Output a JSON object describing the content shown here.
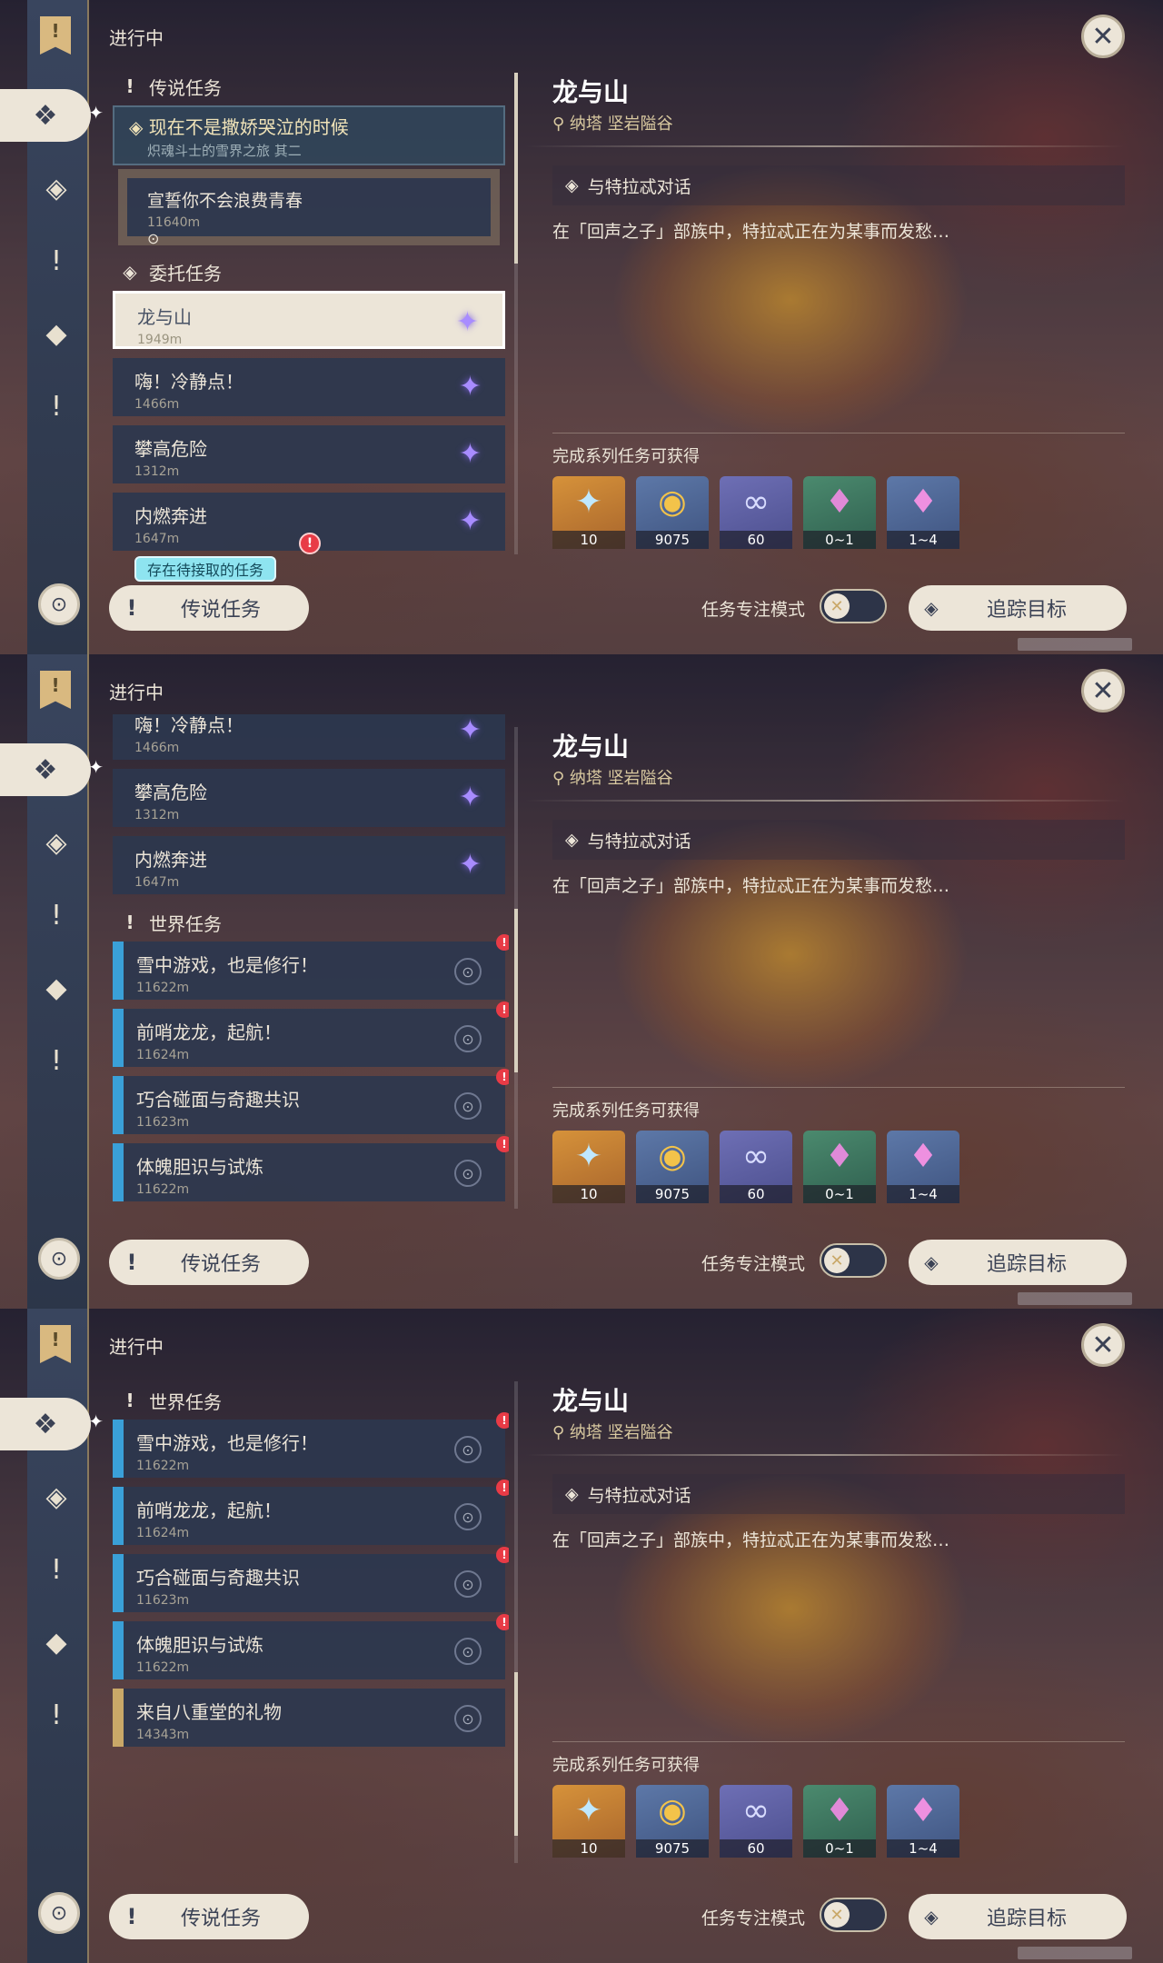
{
  "header": {
    "in_progress": "进行中"
  },
  "sidebar": {
    "flag_glyph": "!",
    "active_glyph": "❖",
    "sparkle": "✦",
    "icons": [
      "◈",
      "!",
      "◆",
      "!"
    ],
    "bottom_glyph": "⊙"
  },
  "close_glyph": "✕",
  "sections": {
    "legend": "传说任务",
    "commission": "委托任务",
    "world": "世界任务"
  },
  "legend_quest": {
    "title": "现在不是撒娇哭泣的时候",
    "subtitle": "炽魂斗士的雪界之旅 其二",
    "sub_title": "宣誓你不会浪费青春",
    "sub_distance": "11640m"
  },
  "commissions": [
    {
      "title": "龙与山",
      "distance": "1949m"
    },
    {
      "title": "嗨！冷静点！",
      "distance": "1466m"
    },
    {
      "title": "攀高危险",
      "distance": "1312m"
    },
    {
      "title": "内燃奔进",
      "distance": "1647m"
    }
  ],
  "world_quests": [
    {
      "title": "雪中游戏，也是修行！",
      "distance": "11622m"
    },
    {
      "title": "前哨龙龙，起航！",
      "distance": "11624m"
    },
    {
      "title": "巧合碰面与奇趣共识",
      "distance": "11623m"
    },
    {
      "title": "体魄胆识与试炼",
      "distance": "11622m"
    },
    {
      "title": "来自八重堂的礼物",
      "distance": "14343m"
    }
  ],
  "pending_banner": "存在待接取的任务",
  "legend_button": "传说任务",
  "detail": {
    "title": "龙与山",
    "location": "纳塔 坚岩隘谷",
    "objective": "与特拉忒对话",
    "description": "在「回声之子」部族中，特拉忒正在为某事而发愁…",
    "rewards_title": "完成系列任务可获得",
    "rewards": [
      {
        "icon": "✦",
        "qty": "10",
        "color": "orange"
      },
      {
        "icon": "◉",
        "qty": "9075",
        "color": "blue"
      },
      {
        "icon": "∞",
        "qty": "60",
        "color": "purple"
      },
      {
        "icon": "♦",
        "qty": "0~1",
        "color": "green"
      },
      {
        "icon": "♦",
        "qty": "1~4",
        "color": "violet"
      }
    ]
  },
  "focus_mode_label": "任务专注模式",
  "toggle_glyph": "✕",
  "track_button": "追踪目标",
  "glyphs": {
    "commission_icon": "✦",
    "pin": "⊙",
    "alert": "!",
    "quest_diamond": "◈",
    "location_pin": "⚲"
  }
}
